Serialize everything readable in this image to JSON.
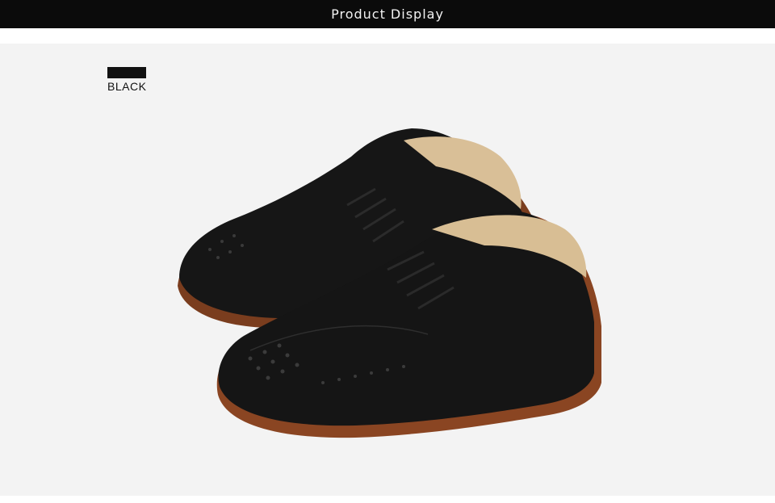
{
  "header": {
    "title": "Product Display"
  },
  "swatch": {
    "label": "BLACK",
    "color": "#111111"
  },
  "product": {
    "image_name": "black-brogue-oxford-shoes"
  }
}
